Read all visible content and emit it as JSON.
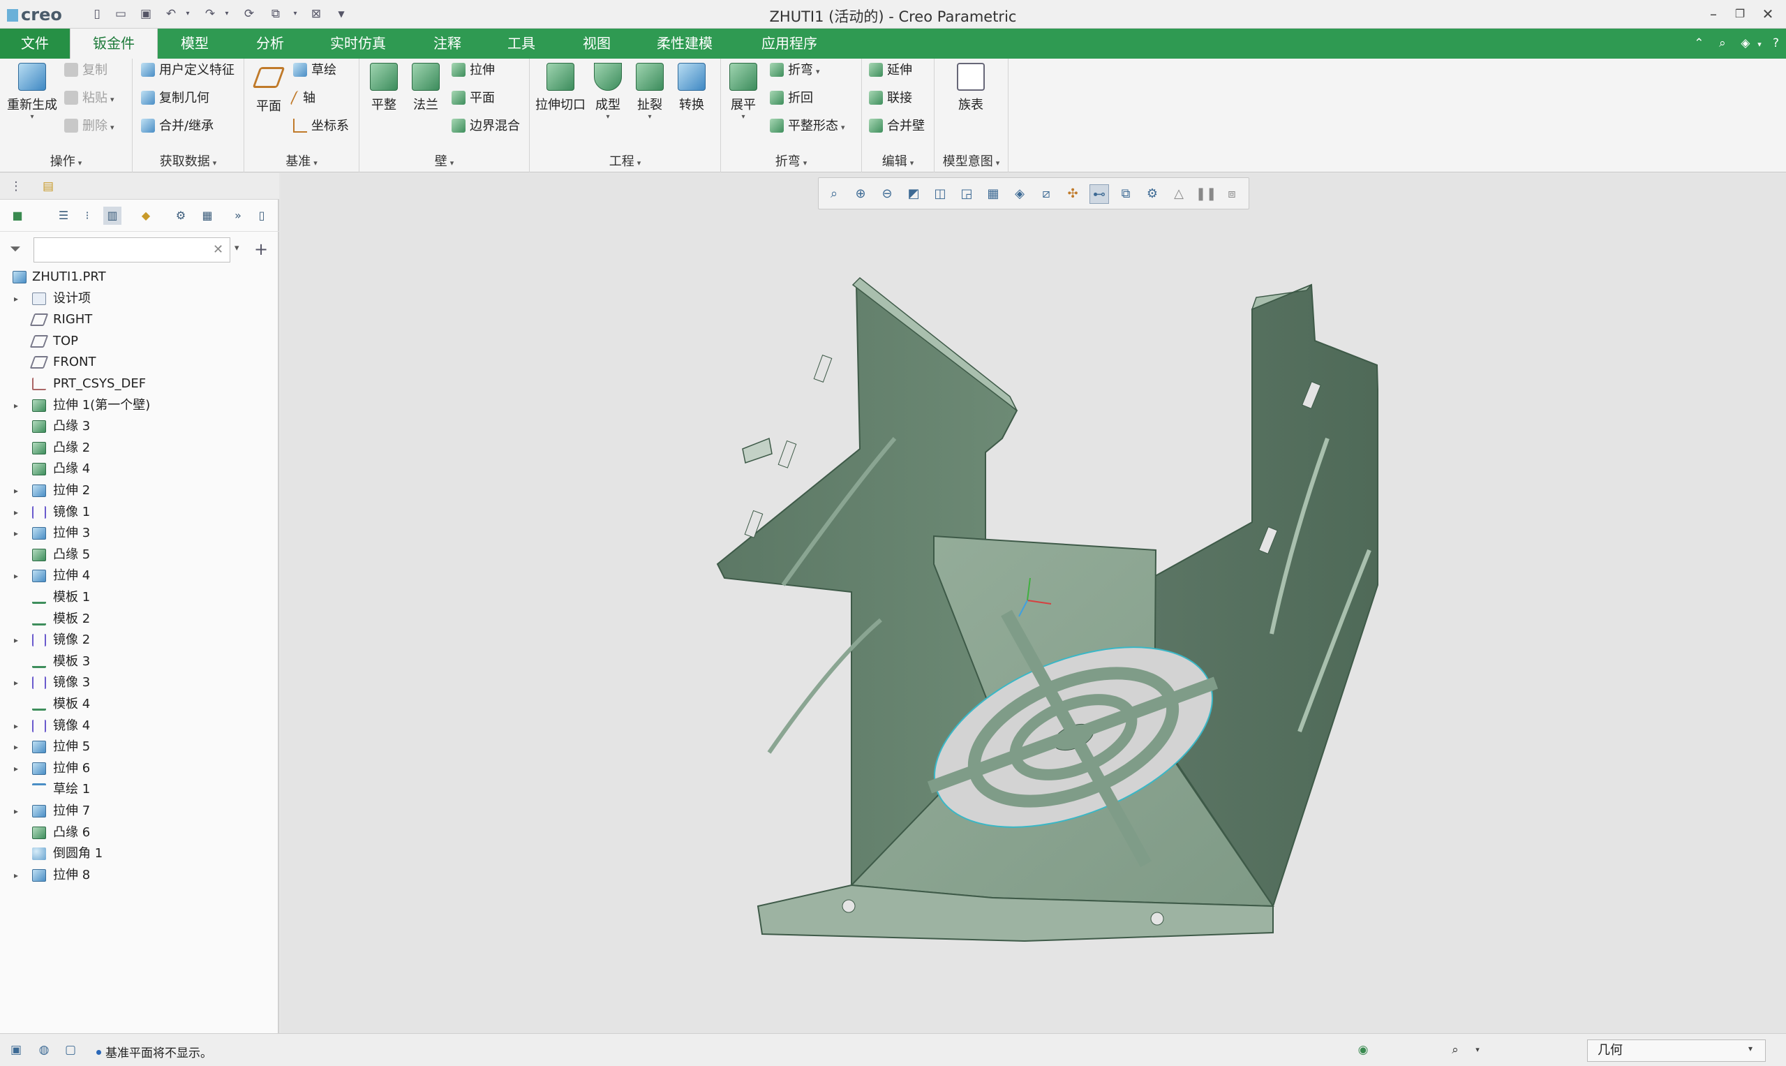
{
  "app": {
    "logo": "creo",
    "window_title": "ZHUTI1 (活动的) - Creo Parametric"
  },
  "quick_access": [
    "new-icon",
    "open-icon",
    "save-icon",
    "undo-icon",
    "redo-icon",
    "regenerate-icon",
    "window-icon",
    "close-window-icon",
    "customize-icon"
  ],
  "tabs": [
    {
      "label": "文件"
    },
    {
      "label": "钣金件"
    },
    {
      "label": "模型"
    },
    {
      "label": "分析"
    },
    {
      "label": "实时仿真"
    },
    {
      "label": "注释"
    },
    {
      "label": "工具"
    },
    {
      "label": "视图"
    },
    {
      "label": "柔性建模"
    },
    {
      "label": "应用程序"
    }
  ],
  "ribbon": {
    "groups": {
      "operations": "操作",
      "get_data": "获取数据",
      "datum": "基准",
      "wall": "壁",
      "engineering": "工程",
      "bend": "折弯",
      "edit": "编辑",
      "model_intent": "模型意图"
    },
    "buttons": {
      "regenerate": "重新生成",
      "copy": "复制",
      "paste": "粘贴",
      "delete": "删除",
      "udf": "用户定义特征",
      "copy_geom": "复制几何",
      "merge": "合并/继承",
      "plane": "平面",
      "sketch": "草绘",
      "axis": "轴",
      "csys": "坐标系",
      "flat": "平整",
      "flange": "法兰",
      "extrude": "拉伸",
      "planar": "平面",
      "boundary_blend": "边界混合",
      "extrude_cut": "拉伸切口",
      "form": "成型",
      "rip": "扯裂",
      "convert": "转换",
      "unbend": "展平",
      "bend": "折弯",
      "bend_back": "折回",
      "flatten_form": "平整形态",
      "extend": "延伸",
      "join": "联接",
      "merge_walls": "合并壁",
      "family_table": "族表"
    }
  },
  "model_tree": {
    "root": "ZHUTI1.PRT",
    "items": [
      {
        "label": "设计项",
        "icon": "design-items-icon",
        "expand": true
      },
      {
        "label": "RIGHT",
        "icon": "datum-plane-icon",
        "expand": false
      },
      {
        "label": "TOP",
        "icon": "datum-plane-icon",
        "expand": false
      },
      {
        "label": "FRONT",
        "icon": "datum-plane-icon",
        "expand": false
      },
      {
        "label": "PRT_CSYS_DEF",
        "icon": "csys-icon",
        "expand": false
      },
      {
        "label": "拉伸 1(第一个壁)",
        "icon": "first-wall-icon",
        "expand": true
      },
      {
        "label": "凸缘 3",
        "icon": "flange-icon",
        "expand": false
      },
      {
        "label": "凸缘 2",
        "icon": "flange-icon",
        "expand": false
      },
      {
        "label": "凸缘 4",
        "icon": "flange-icon",
        "expand": false
      },
      {
        "label": "拉伸 2",
        "icon": "extrude-icon",
        "expand": true
      },
      {
        "label": "镜像 1",
        "icon": "mirror-icon",
        "expand": true
      },
      {
        "label": "拉伸 3",
        "icon": "extrude-icon",
        "expand": true
      },
      {
        "label": "凸缘 5",
        "icon": "flange-icon",
        "expand": false
      },
      {
        "label": "拉伸 4",
        "icon": "extrude-icon",
        "expand": true
      },
      {
        "label": "模板 1",
        "icon": "form-icon",
        "expand": false
      },
      {
        "label": "模板 2",
        "icon": "form-icon",
        "expand": false
      },
      {
        "label": "镜像 2",
        "icon": "mirror-icon",
        "expand": true
      },
      {
        "label": "模板 3",
        "icon": "form-icon",
        "expand": false
      },
      {
        "label": "镜像 3",
        "icon": "mirror-icon",
        "expand": true
      },
      {
        "label": "模板 4",
        "icon": "form-icon",
        "expand": false
      },
      {
        "label": "镜像 4",
        "icon": "mirror-icon",
        "expand": true
      },
      {
        "label": "拉伸 5",
        "icon": "extrude-icon",
        "expand": true
      },
      {
        "label": "拉伸 6",
        "icon": "extrude-icon",
        "expand": true
      },
      {
        "label": "草绘 1",
        "icon": "sketch-icon",
        "expand": false
      },
      {
        "label": "拉伸 7",
        "icon": "extrude-icon",
        "expand": true
      },
      {
        "label": "凸缘 6",
        "icon": "flange-icon",
        "expand": false
      },
      {
        "label": "倒圆角 1",
        "icon": "round-icon",
        "expand": false
      },
      {
        "label": "拉伸 8",
        "icon": "extrude-icon",
        "expand": true
      }
    ]
  },
  "status": {
    "message": "基准平面将不显示。",
    "selection_filter": "几何"
  },
  "colors": {
    "accent_green": "#2f9a52",
    "model_fill": "#7e9b86",
    "model_edge": "#3e5a48",
    "viewport_bg": "#e4e4e4"
  }
}
